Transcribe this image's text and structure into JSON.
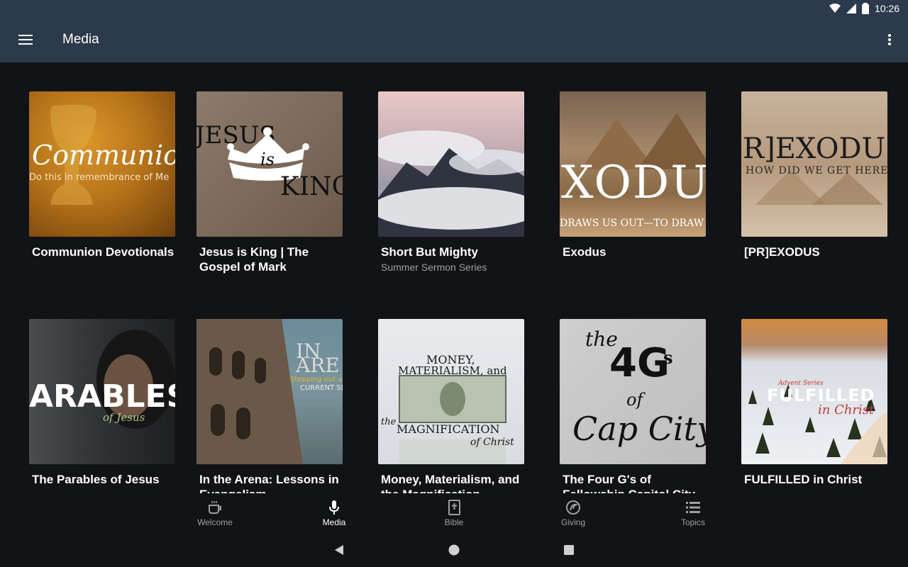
{
  "status_bar": {
    "time": "10:26"
  },
  "app_bar": {
    "title": "Media"
  },
  "thumbnails": {
    "communion_script": "Communion",
    "communion_caption": "Do this in remembrance of Me",
    "jesus_left": "JESUS",
    "jesus_crown_word": "is",
    "jesus_right": "KING",
    "exodus_big": "XODU",
    "exodus_caption": "DRAWS US OUT—TO DRAW",
    "preexodus_big": "R]EXODU",
    "preexodus_caption": "HOW DID WE GET HERE",
    "parables_big": "ARABLES",
    "parables_script": "of Jesus",
    "arena_big": "IN ARE",
    "arena_caption_1": "Stepping out and",
    "arena_caption_2": "CURRENT SE",
    "money_line1": "MONEY,",
    "money_line2": "MATERIALISM, and",
    "money_the": "the",
    "money_line3": "MAGNIFICATION",
    "money_line4": "of Christ",
    "fourgs_the": "the",
    "fourgs_big": "4G",
    "fourgs_s": "s",
    "fourgs_of": "of",
    "fourgs_city": "Cap City",
    "fulfilled_small": "Advent Series",
    "fulfilled_big": "FULFILLED",
    "fulfilled_script": "in Christ"
  },
  "media_items": [
    {
      "title": "Communion Devotionals",
      "subtitle": ""
    },
    {
      "title": "Jesus is King | The Gospel of Mark",
      "subtitle": ""
    },
    {
      "title": "Short But Mighty",
      "subtitle": "Summer Sermon Series"
    },
    {
      "title": "Exodus",
      "subtitle": ""
    },
    {
      "title": "[PR]EXODUS",
      "subtitle": ""
    },
    {
      "title": "The Parables of Jesus",
      "subtitle": ""
    },
    {
      "title": "In the Arena: Lessons in Evangelism",
      "subtitle": ""
    },
    {
      "title": "Money, Materialism, and the Magnification",
      "subtitle": ""
    },
    {
      "title": "The Four G's of Fellowship Capitol City",
      "subtitle": ""
    },
    {
      "title": "FULFILLED in Christ",
      "subtitle": ""
    }
  ],
  "bottom_nav": [
    {
      "label": "Welcome",
      "icon": "coffee-cup-icon",
      "active": false
    },
    {
      "label": "Media",
      "icon": "microphone-icon",
      "active": true
    },
    {
      "label": "Bible",
      "icon": "bible-icon",
      "active": false
    },
    {
      "label": "Giving",
      "icon": "giving-icon",
      "active": false
    },
    {
      "label": "Topics",
      "icon": "list-icon",
      "active": false
    }
  ],
  "colors": {
    "app_bar": "#2c3a4c",
    "background": "#121316",
    "text_primary": "#ffffff",
    "text_secondary": "#9aa0a6"
  }
}
